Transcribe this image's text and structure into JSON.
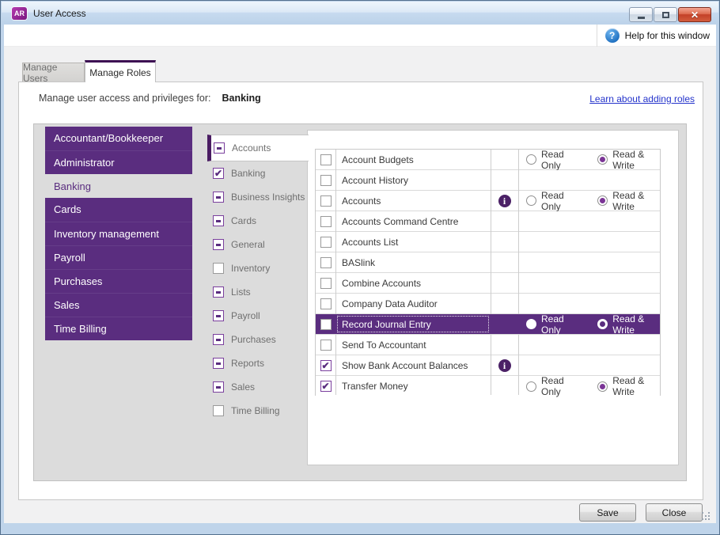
{
  "window": {
    "badge": "AR",
    "title": "User Access",
    "controls": {
      "minimize": "minimize",
      "maximize": "maximize",
      "close": "close"
    }
  },
  "help": {
    "label": "Help for this window",
    "icon": "question-circle-icon"
  },
  "tabs": [
    {
      "label": "Manage Users",
      "active": false
    },
    {
      "label": "Manage Roles",
      "active": true
    }
  ],
  "header": {
    "label": "Manage user access and privileges for:",
    "value": "Banking",
    "link_label": "Learn about adding roles"
  },
  "roles": {
    "selected_index": 2,
    "items": [
      "Accountant/Bookkeeper",
      "Administrator",
      "Banking",
      "Cards",
      "Inventory management",
      "Payroll",
      "Purchases",
      "Sales",
      "Time Billing"
    ]
  },
  "categories": {
    "items": [
      {
        "label": "Accounts",
        "state": "indeterminate",
        "selected": true
      },
      {
        "label": "Banking",
        "state": "checked",
        "selected": false
      },
      {
        "label": "Business Insights",
        "state": "indeterminate",
        "selected": false
      },
      {
        "label": "Cards",
        "state": "indeterminate",
        "selected": false
      },
      {
        "label": "General",
        "state": "indeterminate",
        "selected": false
      },
      {
        "label": "Inventory",
        "state": "unchecked",
        "selected": false
      },
      {
        "label": "Lists",
        "state": "indeterminate",
        "selected": false
      },
      {
        "label": "Payroll",
        "state": "indeterminate",
        "selected": false
      },
      {
        "label": "Purchases",
        "state": "indeterminate",
        "selected": false
      },
      {
        "label": "Reports",
        "state": "indeterminate",
        "selected": false
      },
      {
        "label": "Sales",
        "state": "indeterminate",
        "selected": false
      },
      {
        "label": "Time Billing",
        "state": "unchecked",
        "selected": false
      }
    ]
  },
  "functions": {
    "access_labels": {
      "read_only": "Read Only",
      "read_write": "Read & Write"
    },
    "rows": [
      {
        "label": "Account Budgets",
        "checked": false,
        "info": false,
        "access": "read_write",
        "selected": false
      },
      {
        "label": "Account History",
        "checked": false,
        "info": false,
        "access": null,
        "selected": false
      },
      {
        "label": "Accounts",
        "checked": false,
        "info": true,
        "access": "read_write",
        "selected": false
      },
      {
        "label": "Accounts Command Centre",
        "checked": false,
        "info": false,
        "access": null,
        "selected": false
      },
      {
        "label": "Accounts List",
        "checked": false,
        "info": false,
        "access": null,
        "selected": false
      },
      {
        "label": "BASlink",
        "checked": false,
        "info": false,
        "access": null,
        "selected": false
      },
      {
        "label": "Combine Accounts",
        "checked": false,
        "info": false,
        "access": null,
        "selected": false
      },
      {
        "label": "Company Data Auditor",
        "checked": false,
        "info": false,
        "access": null,
        "selected": false
      },
      {
        "label": "Record Journal Entry",
        "checked": false,
        "info": false,
        "access": "read_write",
        "selected": true
      },
      {
        "label": "Send To Accountant",
        "checked": false,
        "info": false,
        "access": null,
        "selected": false
      },
      {
        "label": "Show Bank Account Balances",
        "checked": true,
        "info": true,
        "access": null,
        "selected": false
      },
      {
        "label": "Transfer Money",
        "checked": true,
        "info": false,
        "access": "read_write",
        "selected": false
      }
    ]
  },
  "footer": {
    "save_label": "Save",
    "close_label": "Close"
  },
  "colors": {
    "brand_purple": "#5a2d7f",
    "dark_purple_accent": "#3d1053",
    "category_selected_bar": "#4a1c63",
    "info_icon": "#4b2166",
    "radio_dot": "#7b3596",
    "link_blue": "#2433cb",
    "titlebar_blue": "#bfd4ea",
    "close_button_red": "#c34128"
  }
}
